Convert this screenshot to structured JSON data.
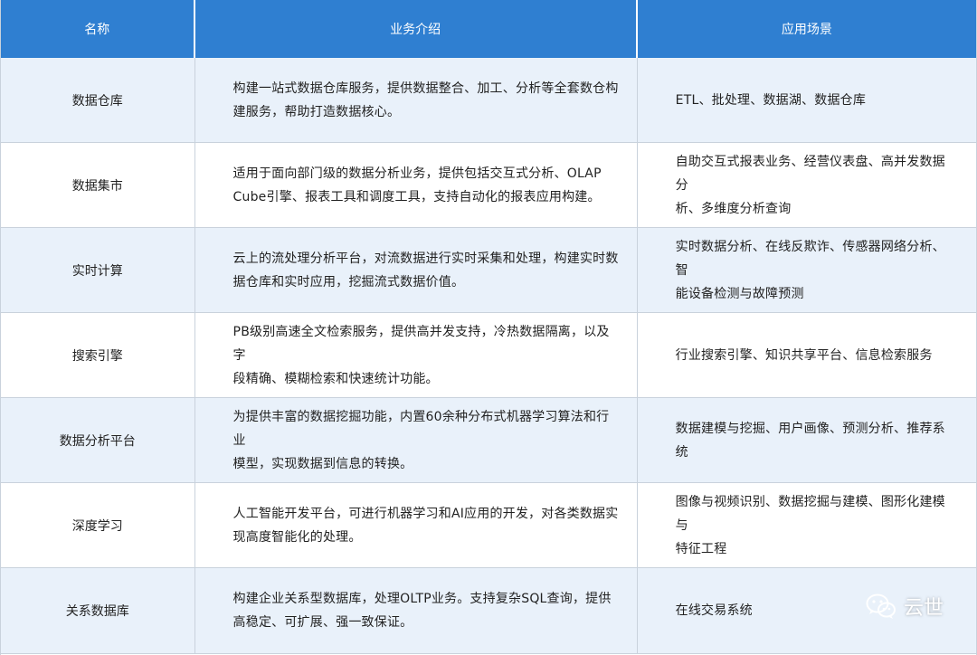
{
  "header": {
    "col1": "名称",
    "col2": "业务介绍",
    "col3": "应用场景"
  },
  "rows": [
    {
      "name": "数据仓库",
      "intro_lines": [
        "构建一站式数据仓库服务，提供数据整合、加工、分析等全套数仓构",
        "建服务，帮助打造数据核心。"
      ],
      "scene_lines": [
        "ETL、批处理、数据湖、数据仓库"
      ]
    },
    {
      "name": "数据集市",
      "intro_lines": [
        "适用于面向部门级的数据分析业务，提供包括交互式分析、OLAP",
        "Cube引擎、报表工具和调度工具，支持自动化的报表应用构建。"
      ],
      "scene_lines": [
        "自助交互式报表业务、经营仪表盘、高并发数据分",
        "析、多维度分析查询"
      ]
    },
    {
      "name": "实时计算",
      "intro_lines": [
        "云上的流处理分析平台，对流数据进行实时采集和处理，构建实时数",
        "据仓库和实时应用，挖掘流式数据价值。"
      ],
      "scene_lines": [
        "实时数据分析、在线反欺诈、传感器网络分析、智",
        "能设备检测与故障预测"
      ]
    },
    {
      "name": "搜索引擎",
      "intro_lines": [
        "PB级别高速全文检索服务，提供高并发支持，冷热数据隔离，以及字",
        "段精确、模糊检索和快速统计功能。"
      ],
      "scene_lines": [
        "行业搜索引擎、知识共享平台、信息检索服务"
      ]
    },
    {
      "name": "数据分析平台",
      "intro_lines": [
        "为提供丰富的数据挖掘功能，内置60余种分布式机器学习算法和行业",
        "模型，实现数据到信息的转换。"
      ],
      "scene_lines": [
        "数据建模与挖掘、用户画像、预测分析、推荐系统"
      ]
    },
    {
      "name": "深度学习",
      "intro_lines": [
        "人工智能开发平台，可进行机器学习和AI应用的开发，对各类数据实",
        "现高度智能化的处理。"
      ],
      "scene_lines": [
        "图像与视频识别、数据挖掘与建模、图形化建模与",
        "特征工程"
      ]
    },
    {
      "name": "关系数据库",
      "intro_lines": [
        "构建企业关系型数据库，处理OLTP业务。支持复杂SQL查询，提供",
        "高稳定、可扩展、强一致保证。"
      ],
      "scene_lines": [
        "在线交易系统"
      ]
    }
  ],
  "watermark": {
    "text": "云世",
    "icon": "wechat-icon"
  },
  "colors": {
    "header_bg": "#2f7fd1",
    "alt_row_bg": "#e9f1fa",
    "border": "#c9d2dc"
  }
}
